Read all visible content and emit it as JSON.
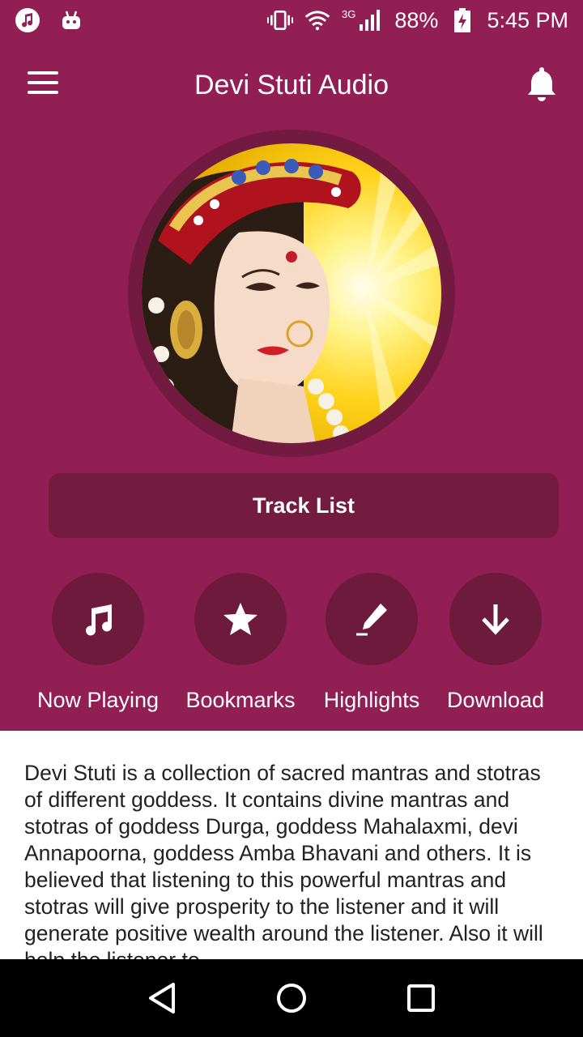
{
  "status_bar": {
    "network": "3G",
    "battery": "88%",
    "time": "5:45 PM"
  },
  "app_bar": {
    "title": "Devi Stuti Audio"
  },
  "track_list": {
    "label": "Track List"
  },
  "actions": [
    {
      "label": "Now Playing",
      "icon": "music-note-icon"
    },
    {
      "label": "Bookmarks",
      "icon": "star-icon"
    },
    {
      "label": "Highlights",
      "icon": "highlighter-icon"
    },
    {
      "label": "Download",
      "icon": "download-arrow-icon"
    }
  ],
  "description": {
    "text": "Devi Stuti is a collection of sacred mantras and stotras of different goddess. It contains divine mantras and stotras of goddess Durga, goddess Mahalaxmi, devi Annapoorna, goddess Amba Bhavani and others. It is believed that listening to this powerful mantras and stotras will give prosperity to the listener and it will generate positive wealth around the listener. Also it will help the listener to"
  },
  "colors": {
    "primary": "#921f53",
    "primary_dark": "#741b40",
    "circle": "#6d1a3c"
  }
}
